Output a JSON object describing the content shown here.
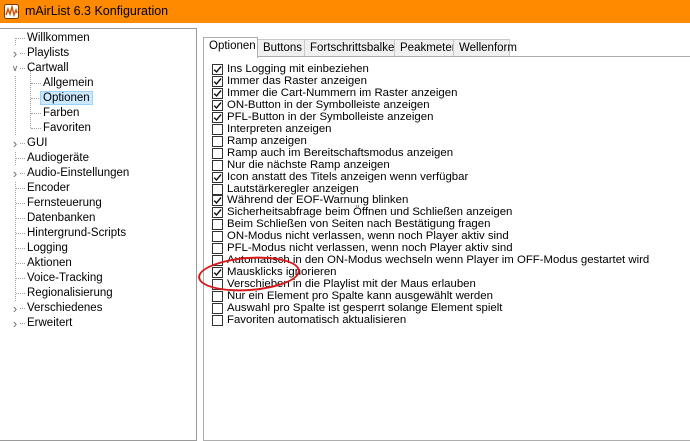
{
  "window": {
    "title": "mAirList 6.3 Konfiguration",
    "icon": "mairlist-app-icon",
    "accent_color": "#ff8a00"
  },
  "tree": {
    "items": [
      {
        "label": "Willkommen",
        "expandable": false,
        "expanded": false,
        "level": 0,
        "selected": false
      },
      {
        "label": "Playlists",
        "expandable": true,
        "expanded": false,
        "level": 0,
        "selected": false
      },
      {
        "label": "Cartwall",
        "expandable": true,
        "expanded": true,
        "level": 0,
        "selected": false
      },
      {
        "label": "Allgemein",
        "expandable": false,
        "expanded": false,
        "level": 1,
        "selected": false
      },
      {
        "label": "Optionen",
        "expandable": false,
        "expanded": false,
        "level": 1,
        "selected": true
      },
      {
        "label": "Farben",
        "expandable": false,
        "expanded": false,
        "level": 1,
        "selected": false
      },
      {
        "label": "Favoriten",
        "expandable": false,
        "expanded": false,
        "level": 1,
        "selected": false
      },
      {
        "label": "GUI",
        "expandable": true,
        "expanded": false,
        "level": 0,
        "selected": false
      },
      {
        "label": "Audiogeräte",
        "expandable": false,
        "expanded": false,
        "level": 0,
        "selected": false
      },
      {
        "label": "Audio-Einstellungen",
        "expandable": true,
        "expanded": false,
        "level": 0,
        "selected": false
      },
      {
        "label": "Encoder",
        "expandable": false,
        "expanded": false,
        "level": 0,
        "selected": false
      },
      {
        "label": "Fernsteuerung",
        "expandable": false,
        "expanded": false,
        "level": 0,
        "selected": false
      },
      {
        "label": "Datenbanken",
        "expandable": false,
        "expanded": false,
        "level": 0,
        "selected": false
      },
      {
        "label": "Hintergrund-Scripts",
        "expandable": false,
        "expanded": false,
        "level": 0,
        "selected": false
      },
      {
        "label": "Logging",
        "expandable": false,
        "expanded": false,
        "level": 0,
        "selected": false
      },
      {
        "label": "Aktionen",
        "expandable": false,
        "expanded": false,
        "level": 0,
        "selected": false
      },
      {
        "label": "Voice-Tracking",
        "expandable": false,
        "expanded": false,
        "level": 0,
        "selected": false
      },
      {
        "label": "Regionalisierung",
        "expandable": false,
        "expanded": false,
        "level": 0,
        "selected": false
      },
      {
        "label": "Verschiedenes",
        "expandable": true,
        "expanded": false,
        "level": 0,
        "selected": false
      },
      {
        "label": "Erweitert",
        "expandable": true,
        "expanded": false,
        "level": 0,
        "selected": false
      }
    ]
  },
  "tabs": {
    "items": [
      {
        "label": "Optionen",
        "active": true
      },
      {
        "label": "Buttons",
        "active": false
      },
      {
        "label": "Fortschrittsbalken",
        "active": false
      },
      {
        "label": "Peakmeter",
        "active": false
      },
      {
        "label": "Wellenform",
        "active": false
      }
    ]
  },
  "options": {
    "items": [
      {
        "label": "Ins Logging mit einbeziehen",
        "checked": true
      },
      {
        "label": "Immer das Raster anzeigen",
        "checked": true
      },
      {
        "label": "Immer die Cart-Nummern im Raster anzeigen",
        "checked": true
      },
      {
        "label": "ON-Button in der Symbolleiste anzeigen",
        "checked": true
      },
      {
        "label": "PFL-Button in der Symbolleiste anzeigen",
        "checked": true
      },
      {
        "label": "Interpreten anzeigen",
        "checked": false
      },
      {
        "label": "Ramp anzeigen",
        "checked": false
      },
      {
        "label": "Ramp auch im Bereitschaftsmodus anzeigen",
        "checked": false
      },
      {
        "label": "Nur die nächste Ramp anzeigen",
        "checked": false
      },
      {
        "label": "Icon anstatt des Titels anzeigen wenn verfügbar",
        "checked": true
      },
      {
        "label": "Lautstärkeregler anzeigen",
        "checked": false
      },
      {
        "label": "Während der EOF-Warnung blinken",
        "checked": true
      },
      {
        "label": "Sicherheitsabfrage beim Öffnen und Schließen anzeigen",
        "checked": true
      },
      {
        "label": "Beim Schließen von Seiten nach Bestätigung fragen",
        "checked": false
      },
      {
        "label": "ON-Modus nicht verlassen, wenn noch Player aktiv sind",
        "checked": false
      },
      {
        "label": "PFL-Modus nicht verlassen, wenn noch Player aktiv sind",
        "checked": false
      },
      {
        "label": "Automatisch in den ON-Modus wechseln wenn Player im OFF-Modus gestartet wird",
        "checked": false
      },
      {
        "label": "Mausklicks ignorieren",
        "checked": true
      },
      {
        "label": "Verschieben in die Playlist mit der Maus erlauben",
        "checked": false
      },
      {
        "label": "Nur ein Element pro Spalte kann ausgewählt werden",
        "checked": false
      },
      {
        "label": "Auswahl pro Spalte ist gesperrt solange Element spielt",
        "checked": false
      },
      {
        "label": "Favoriten automatisch aktualisieren",
        "checked": false
      }
    ]
  },
  "annotation": {
    "shape": "hand-drawn-ellipse",
    "color": "#d81a1a",
    "target": "Mausklicks ignorieren"
  }
}
